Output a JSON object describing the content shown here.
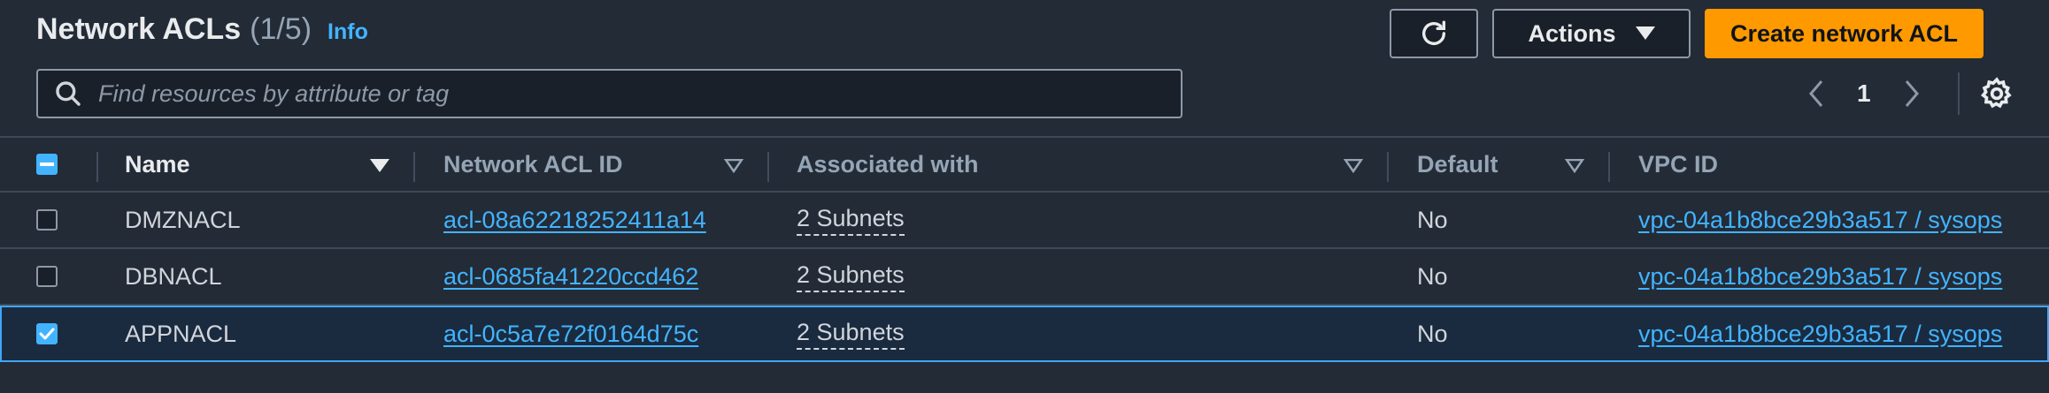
{
  "header": {
    "title": "Network ACLs",
    "count": "(1/5)",
    "info_link": "Info",
    "actions_label": "Actions",
    "create_label": "Create network ACL"
  },
  "search": {
    "placeholder": "Find resources by attribute or tag"
  },
  "pagination": {
    "current_page": "1"
  },
  "table": {
    "columns": [
      "Name",
      "Network ACL ID",
      "Associated with",
      "Default",
      "VPC ID"
    ],
    "rows": [
      {
        "name": "DMZNACL",
        "acl_id": "acl-08a62218252411a14",
        "associated": "2 Subnets",
        "default": "No",
        "vpc": "vpc-04a1b8bce29b3a517 / sysops",
        "selected": false
      },
      {
        "name": "DBNACL",
        "acl_id": "acl-0685fa41220ccd462",
        "associated": "2 Subnets",
        "default": "No",
        "vpc": "vpc-04a1b8bce29b3a517 / sysops",
        "selected": false
      },
      {
        "name": "APPNACL",
        "acl_id": "acl-0c5a7e72f0164d75c",
        "associated": "2 Subnets",
        "default": "No",
        "vpc": "vpc-04a1b8bce29b3a517 / sysops",
        "selected": true
      }
    ]
  },
  "colors": {
    "accent": "#ff9900",
    "link": "#42b4ff",
    "selected_row_bg": "#1a2b40",
    "selected_border": "#42a5f5"
  },
  "icons": [
    "refresh-icon",
    "caret-down-icon",
    "search-icon",
    "chevron-left-icon",
    "chevron-right-icon",
    "settings-gear-icon",
    "sort-caret-icon",
    "checkbox-icon"
  ]
}
